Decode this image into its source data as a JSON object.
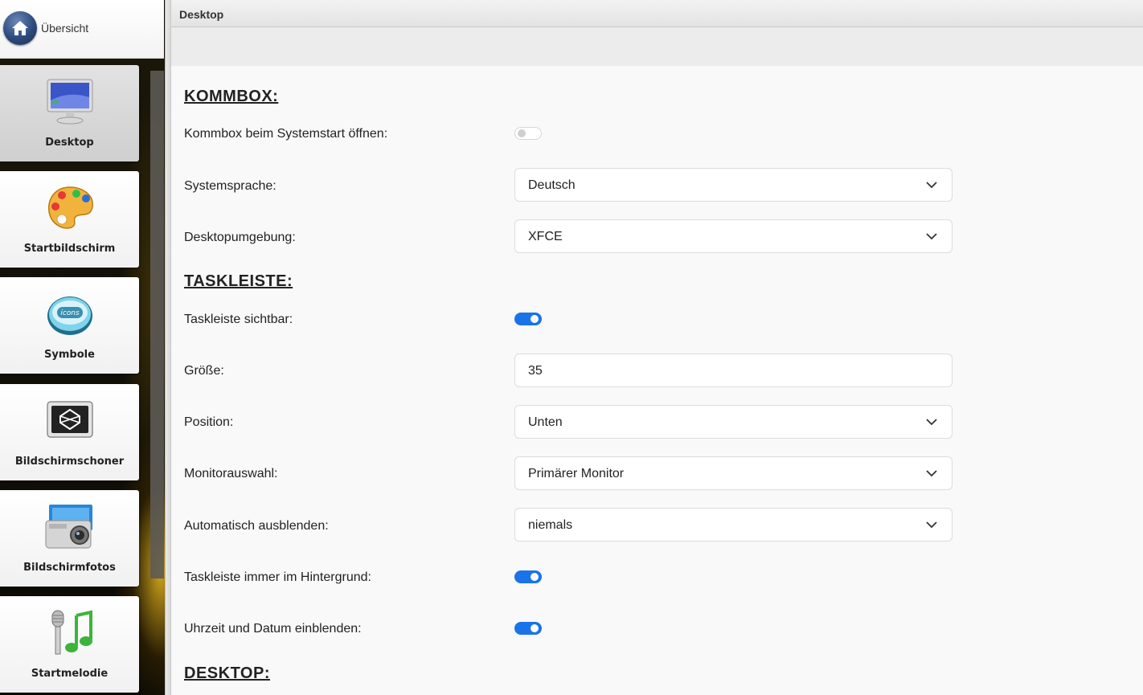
{
  "sidebar": {
    "overview_label": "Übersicht",
    "items": [
      {
        "label": "Desktop",
        "icon": "monitor-icon",
        "active": true
      },
      {
        "label": "Startbildschirm",
        "icon": "paint-palette-icon",
        "active": false
      },
      {
        "label": "Symbole",
        "icon": "icons-badge-icon",
        "active": false
      },
      {
        "label": "Bildschirmschoner",
        "icon": "screensaver-icon",
        "active": false
      },
      {
        "label": "Bildschirmfotos",
        "icon": "camera-icon",
        "active": false
      },
      {
        "label": "Startmelodie",
        "icon": "microphone-music-icon",
        "active": false
      }
    ]
  },
  "header": {
    "title": "Desktop"
  },
  "sections": {
    "kommbox": {
      "heading": "KOMMBOX:",
      "open_on_start": {
        "label": "Kommbox beim Systemstart öffnen:",
        "enabled": false
      },
      "language": {
        "label": "Systemsprache:",
        "value": "Deutsch"
      },
      "desktop_env": {
        "label": "Desktopumgebung:",
        "value": "XFCE"
      }
    },
    "taskbar": {
      "heading": "TASKLEISTE:",
      "visible": {
        "label": "Taskleiste sichtbar:",
        "enabled": true
      },
      "size": {
        "label": "Größe:",
        "value": "35"
      },
      "position": {
        "label": "Position:",
        "value": "Unten"
      },
      "monitor": {
        "label": "Monitorauswahl:",
        "value": "Primärer Monitor"
      },
      "autohide": {
        "label": "Automatisch ausblenden:",
        "value": "niemals"
      },
      "background": {
        "label": "Taskleiste immer im Hintergrund:",
        "enabled": true
      },
      "clock": {
        "label": "Uhrzeit und Datum einblenden:",
        "enabled": true
      }
    },
    "desktop": {
      "heading": "DESKTOP:"
    }
  },
  "colors": {
    "toggle_on": "#1a73e8",
    "toggle_off": "#ffffff"
  }
}
